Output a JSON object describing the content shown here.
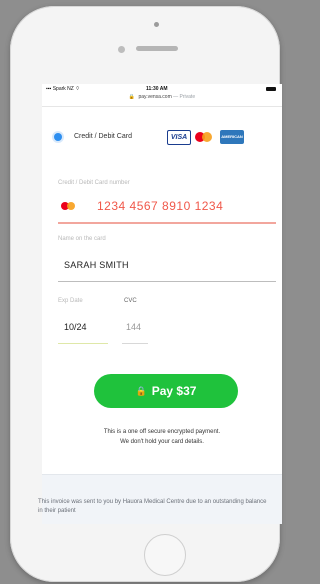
{
  "status_bar": {
    "carrier": "Spark NZ",
    "time": "11:30 AM"
  },
  "url_bar": {
    "domain": "pay.vensa.com",
    "mode": "— Private"
  },
  "payment_method": {
    "label": "Credit / Debit Card",
    "brands": [
      "VISA",
      "Mastercard",
      "American Express"
    ],
    "visa_text": "VISA",
    "amex_text": "AMERICAN EXPRESS"
  },
  "form": {
    "card_number_label": "Credit / Debit Card number",
    "card_number_value": "1234 4567 8910 1234",
    "name_label": "Name on the card",
    "name_value": "SARAH SMITH",
    "exp_label": "Exp Date",
    "exp_value": "10/24",
    "cvc_label": "CVC",
    "cvc_value": "144"
  },
  "pay_button": {
    "label": "Pay $37"
  },
  "secure_note": {
    "line1": "This is a one off secure encrypted payment.",
    "line2": "We don't hold your card details."
  },
  "footer": {
    "text": "This invoice was sent to you by Hauora Medical Centre due to an outstanding balance in their patient"
  },
  "colors": {
    "accent_green": "#1fc23c",
    "card_number_red": "#f0584a",
    "radio_blue": "#2e8ff0"
  }
}
